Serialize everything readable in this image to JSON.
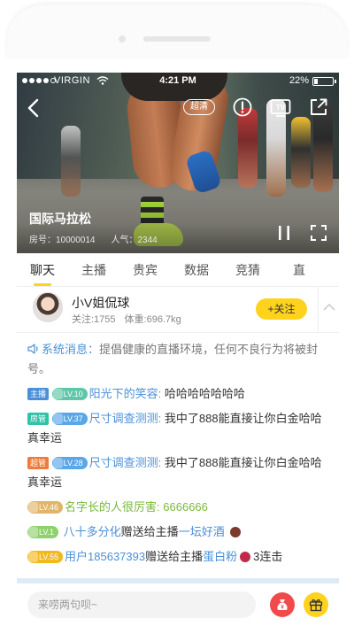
{
  "status_bar": {
    "carrier": "VIRGIN",
    "time": "4:21 PM",
    "battery": "22%",
    "battery_level": 0.22
  },
  "video": {
    "hd_label": "超清",
    "title": "国际马拉松",
    "room_label": "房号：10000014",
    "popularity_label": "人气：2344"
  },
  "tabs": [
    "聊天",
    "主播",
    "贵宾",
    "数据",
    "竞猜",
    "直"
  ],
  "active_tab": 0,
  "streamer": {
    "name": "小V姐侃球",
    "followers": "关注:1755",
    "weight": "体重:696.7kg",
    "follow_label": "+关注"
  },
  "chat": {
    "system": {
      "label": "系统消息：",
      "text": "提倡健康的直播环境，任何不良行为将被封号。"
    },
    "messages": [
      {
        "tag": "主播",
        "tag_color": "#4a90d9",
        "level": "LV.10",
        "level_color": "#5fc7a8",
        "user": "阳光下的笑容:",
        "user_style": "blue",
        "text": "哈哈哈哈哈哈哈"
      },
      {
        "tag": "房管",
        "tag_color": "#2fc2a7",
        "level": "LV.37",
        "level_color": "#5aa7e8",
        "user": "尺寸调查测测:",
        "user_style": "blue",
        "text": "我中了888能直接让你白金哈哈真幸运"
      },
      {
        "tag": "超管",
        "tag_color": "#f07a3a",
        "level": "LV.28",
        "level_color": "#5aa7e8",
        "user": "尺寸调查测测:",
        "user_style": "blue",
        "text": "我中了888能直接让你白金哈哈真幸运"
      },
      {
        "tag": "",
        "tag_color": "",
        "level": "LV.46",
        "level_color": "#e0b56a",
        "user": "名字长的人很厉害:",
        "user_style": "green",
        "text": "6666666",
        "text_style": "green"
      }
    ],
    "gifts": [
      {
        "level": "LV.1",
        "level_color": "#8fd16e",
        "user": "八十多分化",
        "action": "赠送给主播",
        "gift": "一坛好酒",
        "gift_color": "#7b3a2a",
        "combo": ""
      },
      {
        "level": "LV.55",
        "level_color": "#f2b81e",
        "user": "用户185637393",
        "action": "赠送给主播",
        "gift": "蛋白粉",
        "gift_color": "#c22a4a",
        "combo": "3连击"
      }
    ]
  },
  "input": {
    "placeholder": "来唠两句呗~"
  },
  "colors": {
    "accent": "#ffd21e",
    "link_blue": "#4a90d9",
    "green": "#7ab93a"
  }
}
